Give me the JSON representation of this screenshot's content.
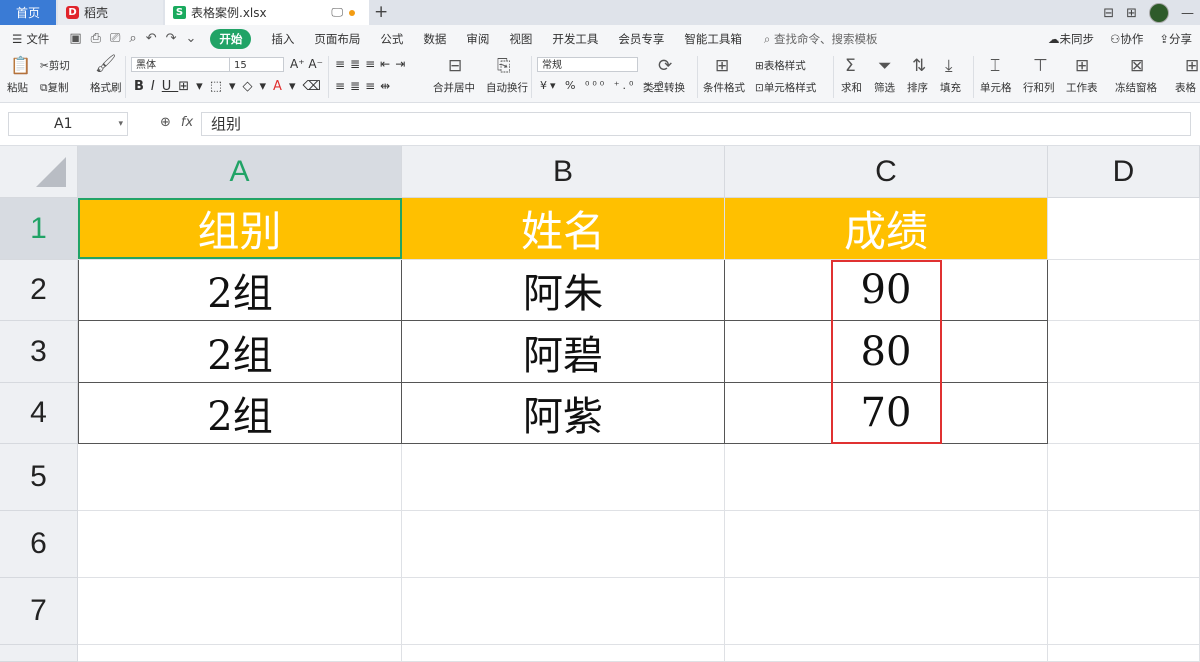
{
  "tabs": {
    "home": "首页",
    "daoke": "稻壳",
    "daoke_icon": "D",
    "file": "表格案例.xlsx",
    "file_icon": "S"
  },
  "menu": {
    "file": "文件",
    "start": "开始",
    "insert": "插入",
    "layout": "页面布局",
    "formula": "公式",
    "data": "数据",
    "review": "审阅",
    "view": "视图",
    "dev": "开发工具",
    "member": "会员专享",
    "smart": "智能工具箱",
    "search_placeholder": "查找命令、搜索模板",
    "sync": "未同步",
    "collab": "协作",
    "share": "分享"
  },
  "ribbon": {
    "paste": "粘贴",
    "cut": "剪切",
    "copy": "复制",
    "format_painter": "格式刷",
    "font_name": "黑体",
    "font_size": "15",
    "merge_center": "合并居中",
    "wrap": "自动换行",
    "number_format": "常规",
    "type_convert": "类型转换",
    "table_style": "表格样式",
    "cond_format": "条件格式",
    "cell_style": "单元格样式",
    "sum": "求和",
    "filter": "筛选",
    "sort": "排序",
    "fill": "填充",
    "cell": "单元格",
    "row_col": "行和列",
    "worksheet": "工作表",
    "freeze": "冻结窗格",
    "table_tools": "表格"
  },
  "formula_bar": {
    "name_box": "A1",
    "fx_label": "fx",
    "content": "组别"
  },
  "grid": {
    "columns": [
      "A",
      "B",
      "C",
      "D"
    ],
    "rows": [
      "1",
      "2",
      "3",
      "4",
      "5",
      "6",
      "7"
    ],
    "header_row": [
      "组别",
      "姓名",
      "成绩"
    ],
    "data_rows": [
      [
        "2组",
        "阿朱",
        "90"
      ],
      [
        "2组",
        "阿碧",
        "80"
      ],
      [
        "2组",
        "阿紫",
        "70"
      ]
    ],
    "selected_cell": "A1",
    "header_fill_color": "#ffc000",
    "highlight_color": "#e03131",
    "accent_color": "#21a366"
  }
}
